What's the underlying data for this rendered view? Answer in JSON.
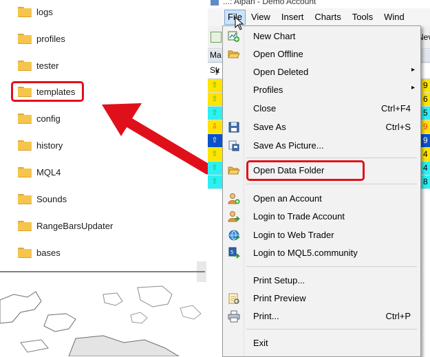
{
  "explorer": {
    "folders": [
      {
        "label": "logs"
      },
      {
        "label": "profiles"
      },
      {
        "label": "tester"
      },
      {
        "label": "templates"
      },
      {
        "label": "config"
      },
      {
        "label": "history"
      },
      {
        "label": "MQL4"
      },
      {
        "label": "Sounds"
      },
      {
        "label": "RangeBarsUpdater"
      },
      {
        "label": "bases"
      }
    ],
    "highlighted_folder": "templates"
  },
  "mt4": {
    "title": "...: Alpari - Demo Account",
    "menu": [
      "File",
      "View",
      "Insert",
      "Charts",
      "Tools",
      "Wind"
    ],
    "market_watch_header": "Ma",
    "symbol_col_header": "Sy",
    "partial_col_header": "k",
    "toolbar_partial": "Nev",
    "quote_cells": [
      "9",
      "6",
      "5",
      "9",
      "9",
      "4",
      "4",
      "8"
    ],
    "quote_colors": {
      "yellow": "#ffe400",
      "cyan": "#2cf0f4",
      "blue": "#0a52c8",
      "up_green": "#29b52b",
      "down_red": "#e23b2b"
    }
  },
  "file_menu": {
    "items": [
      {
        "label": "New Chart",
        "icon": "new-chart-icon"
      },
      {
        "label": "Open Offline",
        "icon": "open-folder-icon"
      },
      {
        "label": "Open Deleted",
        "submenu": "▸"
      },
      {
        "label": "Profiles",
        "submenu": "▸"
      },
      {
        "label": "Close",
        "shortcut": "Ctrl+F4"
      },
      {
        "label": "Save As",
        "shortcut": "Ctrl+S",
        "icon": "floppy-disk-icon"
      },
      {
        "label": "Save As Picture...",
        "icon": "save-picture-icon"
      },
      {
        "label": "Open Data Folder",
        "icon": "open-folder-icon"
      },
      {
        "label": "Open an Account",
        "icon": "user-add-icon"
      },
      {
        "label": "Login to Trade Account",
        "icon": "user-login-icon"
      },
      {
        "label": "Login to Web Trader",
        "icon": "web-trader-icon"
      },
      {
        "label": "Login to MQL5.community",
        "icon": "mql5-icon"
      },
      {
        "label": "Print Setup..."
      },
      {
        "label": "Print Preview",
        "icon": "print-preview-icon"
      },
      {
        "label": "Print...",
        "shortcut": "Ctrl+P",
        "icon": "printer-icon"
      },
      {
        "label": "Exit"
      }
    ],
    "highlighted_item": "Open Data Folder"
  },
  "colors": {
    "highlight_red": "#e0101a",
    "folder_yellow": "#f5c54c",
    "menu_bg": "#f2f2f2"
  }
}
